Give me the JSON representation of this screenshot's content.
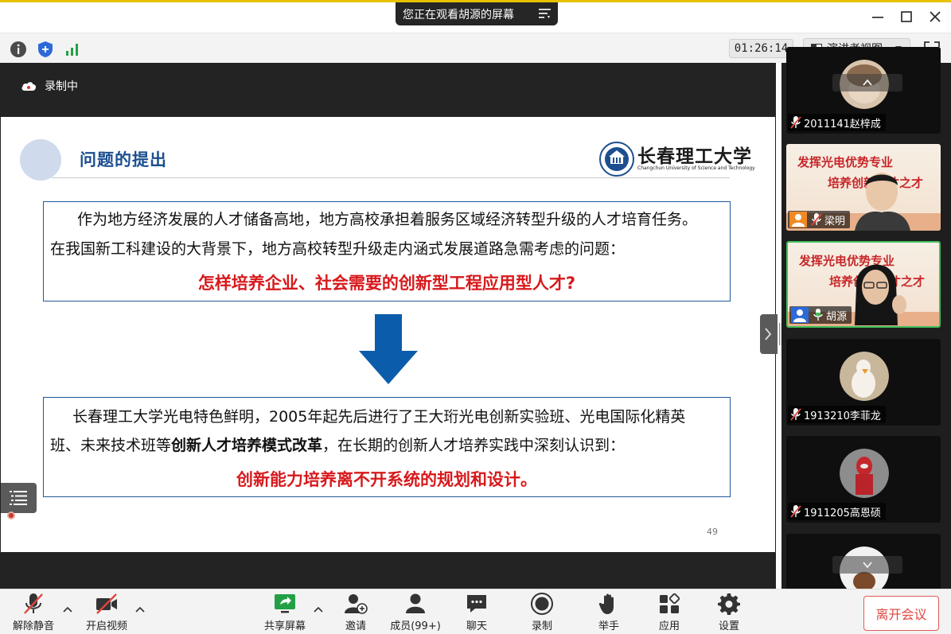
{
  "window": {
    "share_notice": "您正在观看胡源的屏幕"
  },
  "info_bar": {
    "timer": "01:26:14",
    "view_label": "演讲者视图"
  },
  "recording": {
    "label": "录制中"
  },
  "slide": {
    "title": "问题的提出",
    "logo_cn": "长春理工大学",
    "logo_en": "Changchun University of Science and Technology",
    "box1_line1": "作为地方经济发展的人才储备高地，地方高校承担着服务区域经济转型升级的人才培育任务。",
    "box1_line2": "在我国新工科建设的大背景下，地方高校转型升级走内涵式发展道路急需考虑的问题：",
    "box1_emphasis": "怎样培养企业、社会需要的创新型工程应用型人才?",
    "box2_line1": "长春理工大学光电特色鲜明，2005年起先后进行了王大珩光电创新实验班、光电国际化精英",
    "box2_line2_a": "班、未来技术班等",
    "box2_line2_b": "创新人才培养模式改革",
    "box2_line2_c": "，在长期的创新人才培养实践中深刻认识到：",
    "box2_emphasis": "创新能力培养离不开系统的规划和设计。",
    "page_number": "49"
  },
  "participants": [
    {
      "name": "2011141赵梓成",
      "muted": true
    },
    {
      "name": "梁明",
      "muted": true,
      "bg_line1": "发挥光电优势专业",
      "bg_line2": "培养创新人才之才"
    },
    {
      "name": "胡源",
      "muted": false,
      "speaking": true,
      "bg_line1": "发挥光电优势专业",
      "bg_line2": "培养创新人才之才"
    },
    {
      "name": "1913210李菲龙",
      "muted": true
    },
    {
      "name": "1911205高恩硕",
      "muted": true
    }
  ],
  "toolbar": {
    "unmute": "解除静音",
    "start_video": "开启视频",
    "share_screen": "共享屏幕",
    "invite": "邀请",
    "members": "成员(99+)",
    "chat": "聊天",
    "record": "录制",
    "raise_hand": "举手",
    "apps": "应用",
    "settings": "设置",
    "leave": "离开会议"
  },
  "colors": {
    "leave_red": "#e0463f",
    "slide_blue": "#1c4f8f",
    "emphasis_red": "#d7191c",
    "speaking_green": "#3fbf5a"
  }
}
